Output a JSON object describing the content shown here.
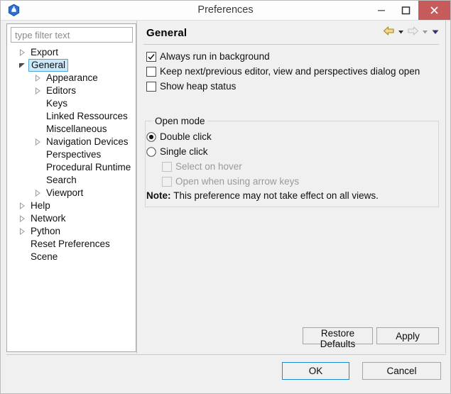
{
  "window": {
    "title": "Preferences",
    "app_icon": "eclipse-app-icon",
    "controls": {
      "minimize": "minimize-icon",
      "maximize": "maximize-icon",
      "close": "close-icon",
      "close_color": "#c75b5b"
    }
  },
  "sidebar": {
    "filter": {
      "placeholder": "type filter text",
      "value": ""
    },
    "items": [
      {
        "label": "Export",
        "level": 0,
        "expandable": true,
        "expanded": false,
        "selected": false
      },
      {
        "label": "General",
        "level": 0,
        "expandable": true,
        "expanded": true,
        "selected": true
      },
      {
        "label": "Appearance",
        "level": 1,
        "expandable": true,
        "expanded": false,
        "selected": false
      },
      {
        "label": "Editors",
        "level": 1,
        "expandable": true,
        "expanded": false,
        "selected": false
      },
      {
        "label": "Keys",
        "level": 1,
        "expandable": false,
        "expanded": false,
        "selected": false
      },
      {
        "label": "Linked Ressources",
        "level": 1,
        "expandable": false,
        "expanded": false,
        "selected": false
      },
      {
        "label": "Miscellaneous",
        "level": 1,
        "expandable": false,
        "expanded": false,
        "selected": false
      },
      {
        "label": "Navigation Devices",
        "level": 1,
        "expandable": true,
        "expanded": false,
        "selected": false
      },
      {
        "label": "Perspectives",
        "level": 1,
        "expandable": false,
        "expanded": false,
        "selected": false
      },
      {
        "label": "Procedural Runtime",
        "level": 1,
        "expandable": false,
        "expanded": false,
        "selected": false
      },
      {
        "label": "Search",
        "level": 1,
        "expandable": false,
        "expanded": false,
        "selected": false
      },
      {
        "label": "Viewport",
        "level": 1,
        "expandable": true,
        "expanded": false,
        "selected": false
      },
      {
        "label": "Help",
        "level": 0,
        "expandable": true,
        "expanded": false,
        "selected": false
      },
      {
        "label": "Network",
        "level": 0,
        "expandable": true,
        "expanded": false,
        "selected": false
      },
      {
        "label": "Python",
        "level": 0,
        "expandable": true,
        "expanded": false,
        "selected": false
      },
      {
        "label": "Reset Preferences",
        "level": 0,
        "expandable": false,
        "expanded": false,
        "selected": false
      },
      {
        "label": "Scene",
        "level": 0,
        "expandable": false,
        "expanded": false,
        "selected": false
      }
    ]
  },
  "page": {
    "title": "General",
    "nav": {
      "back_icon": "back-arrow-icon",
      "back_enabled": true,
      "back_color": "#e3c04a",
      "back_menu_icon": "chevron-down-icon",
      "forward_icon": "forward-arrow-icon",
      "forward_enabled": false,
      "forward_color": "#d7d7d7",
      "forward_menu_icon": "chevron-down-icon",
      "overflow_menu_icon": "chevron-down-icon"
    },
    "checkboxes": [
      {
        "label": "Always run in background",
        "checked": true,
        "enabled": true
      },
      {
        "label": "Keep next/previous editor, view and perspectives dialog open",
        "checked": false,
        "enabled": true
      },
      {
        "label": "Show heap status",
        "checked": false,
        "enabled": true
      }
    ],
    "open_mode": {
      "legend": "Open mode",
      "radios": [
        {
          "label": "Double click",
          "selected": true,
          "enabled": true
        },
        {
          "label": "Single click",
          "selected": false,
          "enabled": true
        }
      ],
      "sub_checkboxes": [
        {
          "label": "Select on hover",
          "checked": false,
          "enabled": false
        },
        {
          "label": "Open when using arrow keys",
          "checked": false,
          "enabled": false
        }
      ],
      "note_label": "Note:",
      "note_text": "This preference may not take effect on all views."
    },
    "buttons": {
      "restore_defaults": "Restore Defaults",
      "apply": "Apply"
    }
  },
  "footer": {
    "ok": "OK",
    "cancel": "Cancel"
  }
}
